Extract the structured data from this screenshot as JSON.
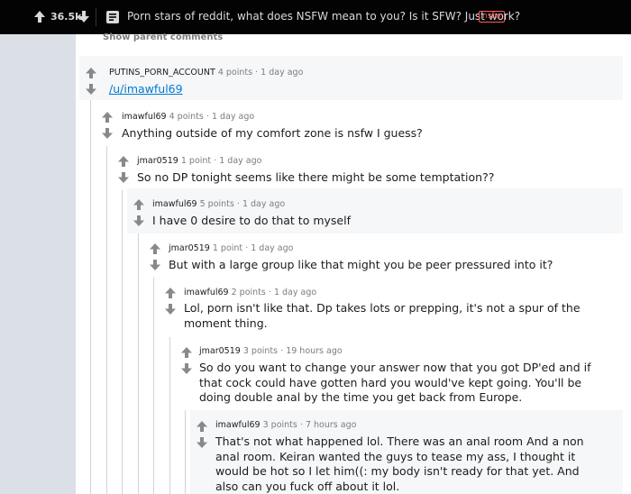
{
  "header": {
    "score": "36.5k",
    "title": "Porn stars of reddit, what does NSFW mean to you? Is it SFW? Just work?",
    "nsfw_tag": "nsfw"
  },
  "thread": {
    "show_parent_label": "Show parent comments"
  },
  "comments": [
    {
      "author": "PUTINS_PORN_ACCOUNT",
      "points": "4 points",
      "dot": "·",
      "time": "1 day ago",
      "body": "/u/imawful69"
    },
    {
      "author": "imawful69",
      "points": "4 points",
      "dot": "·",
      "time": "1 day ago",
      "body": "Anything outside of my comfort zone is nsfw I guess?"
    },
    {
      "author": "jmar0519",
      "points": "1 point",
      "dot": "·",
      "time": "1 day ago",
      "body": "So no DP tonight seems like there might be some temptation??"
    },
    {
      "author": "imawful69",
      "points": "5 points",
      "dot": "·",
      "time": "1 day ago",
      "body": "I have 0 desire to do that to myself"
    },
    {
      "author": "jmar0519",
      "points": "1 point",
      "dot": "·",
      "time": "1 day ago",
      "body": "But with a large group like that might you be peer pressured into it?"
    },
    {
      "author": "imawful69",
      "points": "2 points",
      "dot": "·",
      "time": "1 day ago",
      "body": "Lol, porn isn't like that. Dp takes lots or prepping, it's not a spur of the moment thing."
    },
    {
      "author": "jmar0519",
      "points": "3 points",
      "dot": "·",
      "time": "19 hours ago",
      "body": "So do you want to change your answer now that you got DP'ed and if that cock could have gotten hard you would've kept going. You'll be doing double anal by the time you get back from Europe."
    },
    {
      "author": "imawful69",
      "points": "3 points",
      "dot": "·",
      "time": "7 hours ago",
      "body": "That's not what happened lol. There was an anal room And a non anal room. Keiran wanted the guys to tease my ass, I thought it would be hot so I let him((: my body isn't ready for that yet. And also can you fuck off about it lol."
    }
  ],
  "colors": {
    "topbar": "#030303",
    "link": "#0079d3",
    "nsfw": "#ff585b",
    "shade": "#f6f7f8"
  }
}
